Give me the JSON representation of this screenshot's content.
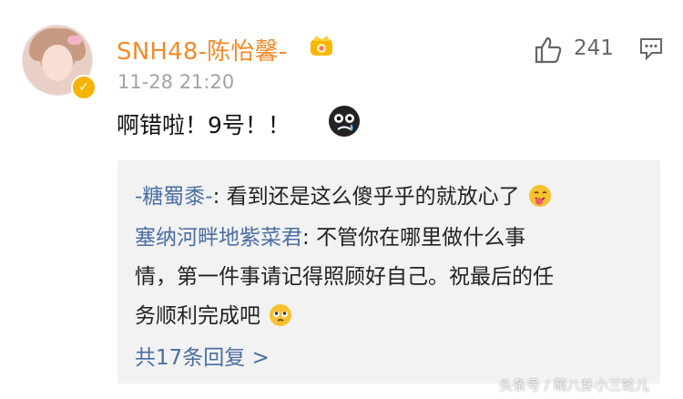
{
  "post": {
    "username": "SNH48-陈怡馨-",
    "timestamp": "11-28 21:20",
    "text": "啊错啦！9号！！",
    "like_count": "241",
    "icons": {
      "avatar": "avatar-photo",
      "verified": "verified-badge-icon",
      "crown": "crown-icon",
      "like": "thumbs-up-icon",
      "comment": "comment-icon",
      "emoji": "sad-face-emoji"
    },
    "colors": {
      "username": "#f28a2b",
      "reply_user": "#4a6fa2",
      "timestamp": "#a3a3a3",
      "reply_bg": "#f2f2f2"
    }
  },
  "replies": {
    "items": [
      {
        "user": "-糖蜀黍-",
        "separator": ": ",
        "text": "看到还是这么傻乎乎的就放心了"
      },
      {
        "user": "塞纳河畔地紫菜君",
        "separator": ": ",
        "text": "不管你在哪里做什么事"
      }
    ],
    "continuation_1": "情，第一件事请记得照顾好自己。祝最后的任",
    "continuation_2": "务顺利完成吧",
    "more_label": "共17条回复 >"
  },
  "watermark": "头条号 / 萌八卦小三轮儿"
}
